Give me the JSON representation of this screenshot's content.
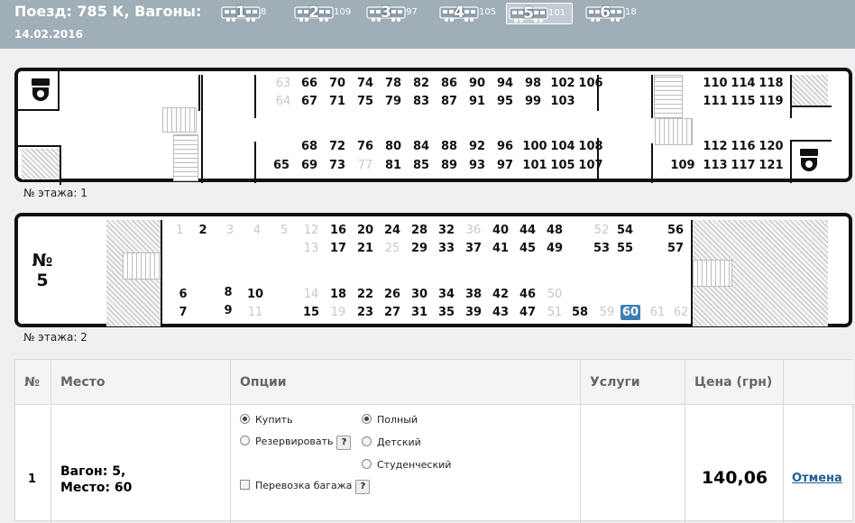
{
  "header": {
    "title": "Поезд: 785 К, Вагоны:",
    "date": "14.02.2016",
    "wagons": [
      {
        "num": "1",
        "seats": "8",
        "selected": false
      },
      {
        "num": "2",
        "seats": "109",
        "selected": false
      },
      {
        "num": "3",
        "seats": "97",
        "selected": false
      },
      {
        "num": "4",
        "seats": "105",
        "selected": false
      },
      {
        "num": "5",
        "seats": "101",
        "selected": true
      },
      {
        "num": "6",
        "seats": "18",
        "selected": false
      }
    ]
  },
  "car": {
    "number_symbol": "№",
    "number": "5",
    "floor1_label": "№ этажа: 1",
    "floor2_label": "№ этажа: 2",
    "floor1_seats": [
      {
        "n": "63",
        "available": false
      },
      {
        "n": "64",
        "available": false
      },
      {
        "n": "66",
        "available": true
      },
      {
        "n": "67",
        "available": true
      },
      {
        "n": "70",
        "available": true
      },
      {
        "n": "71",
        "available": true
      },
      {
        "n": "74",
        "available": true
      },
      {
        "n": "75",
        "available": true
      },
      {
        "n": "78",
        "available": true
      },
      {
        "n": "79",
        "available": true
      },
      {
        "n": "82",
        "available": true
      },
      {
        "n": "83",
        "available": true
      },
      {
        "n": "86",
        "available": true
      },
      {
        "n": "87",
        "available": true
      },
      {
        "n": "90",
        "available": true
      },
      {
        "n": "91",
        "available": true
      },
      {
        "n": "94",
        "available": true
      },
      {
        "n": "95",
        "available": true
      },
      {
        "n": "98",
        "available": true
      },
      {
        "n": "99",
        "available": true
      },
      {
        "n": "102",
        "available": true
      },
      {
        "n": "103",
        "available": true
      },
      {
        "n": "106",
        "available": true
      },
      {
        "n": "65",
        "available": true
      },
      {
        "n": "68",
        "available": true
      },
      {
        "n": "69",
        "available": true
      },
      {
        "n": "72",
        "available": true
      },
      {
        "n": "73",
        "available": true
      },
      {
        "n": "76",
        "available": true
      },
      {
        "n": "77",
        "available": false
      },
      {
        "n": "80",
        "available": true
      },
      {
        "n": "81",
        "available": true
      },
      {
        "n": "84",
        "available": true
      },
      {
        "n": "85",
        "available": true
      },
      {
        "n": "88",
        "available": true
      },
      {
        "n": "89",
        "available": true
      },
      {
        "n": "92",
        "available": true
      },
      {
        "n": "93",
        "available": true
      },
      {
        "n": "96",
        "available": true
      },
      {
        "n": "97",
        "available": true
      },
      {
        "n": "100",
        "available": true
      },
      {
        "n": "101",
        "available": true
      },
      {
        "n": "104",
        "available": true
      },
      {
        "n": "105",
        "available": true
      },
      {
        "n": "108",
        "available": true
      },
      {
        "n": "107",
        "available": true
      },
      {
        "n": "110",
        "available": true
      },
      {
        "n": "111",
        "available": true
      },
      {
        "n": "114",
        "available": true
      },
      {
        "n": "115",
        "available": true
      },
      {
        "n": "118",
        "available": true
      },
      {
        "n": "119",
        "available": true
      },
      {
        "n": "112",
        "available": true
      },
      {
        "n": "113",
        "available": true
      },
      {
        "n": "116",
        "available": true
      },
      {
        "n": "117",
        "available": true
      },
      {
        "n": "120",
        "available": true
      },
      {
        "n": "121",
        "available": true
      },
      {
        "n": "109",
        "available": true
      }
    ],
    "floor2_seats": [
      {
        "n": "1",
        "available": false
      },
      {
        "n": "2",
        "available": true
      },
      {
        "n": "3",
        "available": false
      },
      {
        "n": "4",
        "available": false
      },
      {
        "n": "5",
        "available": false
      },
      {
        "n": "12",
        "available": false
      },
      {
        "n": "13",
        "available": false
      },
      {
        "n": "16",
        "available": true
      },
      {
        "n": "17",
        "available": true
      },
      {
        "n": "20",
        "available": true
      },
      {
        "n": "21",
        "available": true
      },
      {
        "n": "24",
        "available": true
      },
      {
        "n": "25",
        "available": false
      },
      {
        "n": "28",
        "available": true
      },
      {
        "n": "29",
        "available": true
      },
      {
        "n": "32",
        "available": true
      },
      {
        "n": "33",
        "available": true
      },
      {
        "n": "36",
        "available": false
      },
      {
        "n": "37",
        "available": true
      },
      {
        "n": "40",
        "available": true
      },
      {
        "n": "41",
        "available": true
      },
      {
        "n": "44",
        "available": true
      },
      {
        "n": "45",
        "available": true
      },
      {
        "n": "48",
        "available": true
      },
      {
        "n": "49",
        "available": true
      },
      {
        "n": "52",
        "available": false
      },
      {
        "n": "53",
        "available": true
      },
      {
        "n": "54",
        "available": true
      },
      {
        "n": "55",
        "available": true
      },
      {
        "n": "56",
        "available": true
      },
      {
        "n": "57",
        "available": true
      },
      {
        "n": "6",
        "available": true
      },
      {
        "n": "7",
        "available": true
      },
      {
        "n": "8",
        "available": true
      },
      {
        "n": "9",
        "available": true
      },
      {
        "n": "10",
        "available": true
      },
      {
        "n": "11",
        "available": false
      },
      {
        "n": "14",
        "available": false
      },
      {
        "n": "15",
        "available": true
      },
      {
        "n": "18",
        "available": true
      },
      {
        "n": "19",
        "available": false
      },
      {
        "n": "22",
        "available": true
      },
      {
        "n": "23",
        "available": true
      },
      {
        "n": "26",
        "available": true
      },
      {
        "n": "27",
        "available": true
      },
      {
        "n": "30",
        "available": true
      },
      {
        "n": "31",
        "available": true
      },
      {
        "n": "34",
        "available": true
      },
      {
        "n": "35",
        "available": true
      },
      {
        "n": "38",
        "available": true
      },
      {
        "n": "39",
        "available": true
      },
      {
        "n": "42",
        "available": true
      },
      {
        "n": "43",
        "available": true
      },
      {
        "n": "46",
        "available": true
      },
      {
        "n": "47",
        "available": true
      },
      {
        "n": "50",
        "available": false
      },
      {
        "n": "51",
        "available": false
      },
      {
        "n": "58",
        "available": true
      },
      {
        "n": "59",
        "available": false
      },
      {
        "n": "60",
        "available": true,
        "selected": true
      },
      {
        "n": "61",
        "available": false
      },
      {
        "n": "62",
        "available": false
      }
    ]
  },
  "table": {
    "headers": {
      "num": "№",
      "place": "Место",
      "options": "Опции",
      "services": "Услуги",
      "price": "Цена (грн)"
    },
    "row": {
      "num": "1",
      "place_line1": "Вагон: 5,",
      "place_line2": "Место: 60",
      "opt_buy": "Купить",
      "opt_reserve": "Резервировать",
      "opt_full": "Полный",
      "opt_child": "Детский",
      "opt_student": "Студенческий",
      "opt_luggage": "Перевозка багажа",
      "help": "?",
      "price": "140,06",
      "cancel": "Отмена",
      "buy_selected": true,
      "full_selected": true
    }
  },
  "colors": {
    "header_bg": "#a0aeb7",
    "selected_seat": "#3d7fb3",
    "link": "#1f5e95"
  }
}
